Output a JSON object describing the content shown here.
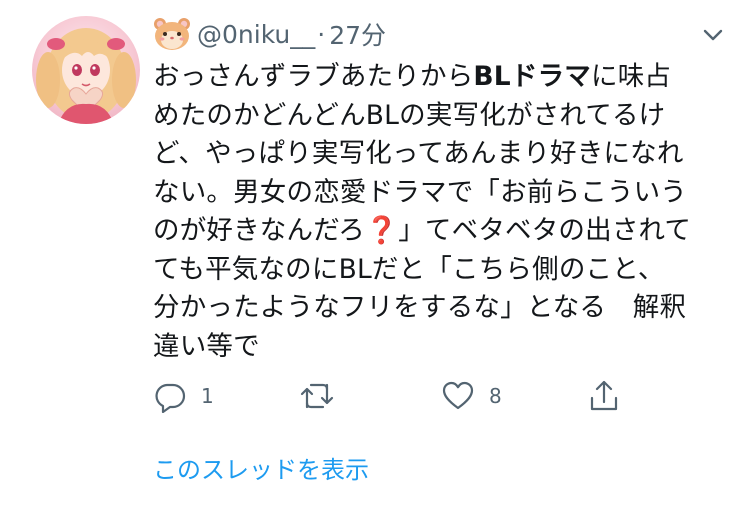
{
  "tweet": {
    "author": {
      "emoji": "hamster-face",
      "handle": "@0niku__",
      "separator": "·",
      "time": "27分"
    },
    "body_lines": [
      [
        "おっさんずラブあたりから",
        "BLドラマ",
        "に味占"
      ],
      [
        "めたのかどんどんBLの実写化がされてるけ"
      ],
      [
        "ど、やっぱり実写化ってあんまり好きになれ"
      ],
      [
        "ない。男女の恋愛ドラマで「お前らこういう"
      ],
      [
        "のが好きなんだろ",
        "❓",
        "」てベタベタの出されて"
      ],
      [
        "ても平気なのにBLだと「こちら側のこと、"
      ],
      [
        "分かったようなフリをするな」となる　解釈"
      ],
      [
        "違い等で"
      ]
    ],
    "body": {
      "l1a": "おっさんずラブあたりから",
      "l1b": "BLドラマ",
      "l1c": "に味占",
      "l2": "めたのかどんどんBLの実写化がされてるけ",
      "l3": "ど、やっぱり実写化ってあんまり好きになれ",
      "l4": "ない。男女の恋愛ドラマで「お前らこういう",
      "l5a": "のが好きなんだろ",
      "l5b": "❓",
      "l5c": "」てベタベタの出されて",
      "l6": "ても平気なのにBLだと「こちら側のこと、",
      "l7": "分かったようなフリをするな」となる　解釈",
      "l8": "違い等で"
    },
    "actions": {
      "reply_count": "1",
      "retweet_count": "",
      "like_count": "8"
    },
    "show_thread": "このスレッドを表示"
  },
  "colors": {
    "text": "#14171a",
    "secondary": "#536471",
    "link": "#1d9bf0"
  }
}
